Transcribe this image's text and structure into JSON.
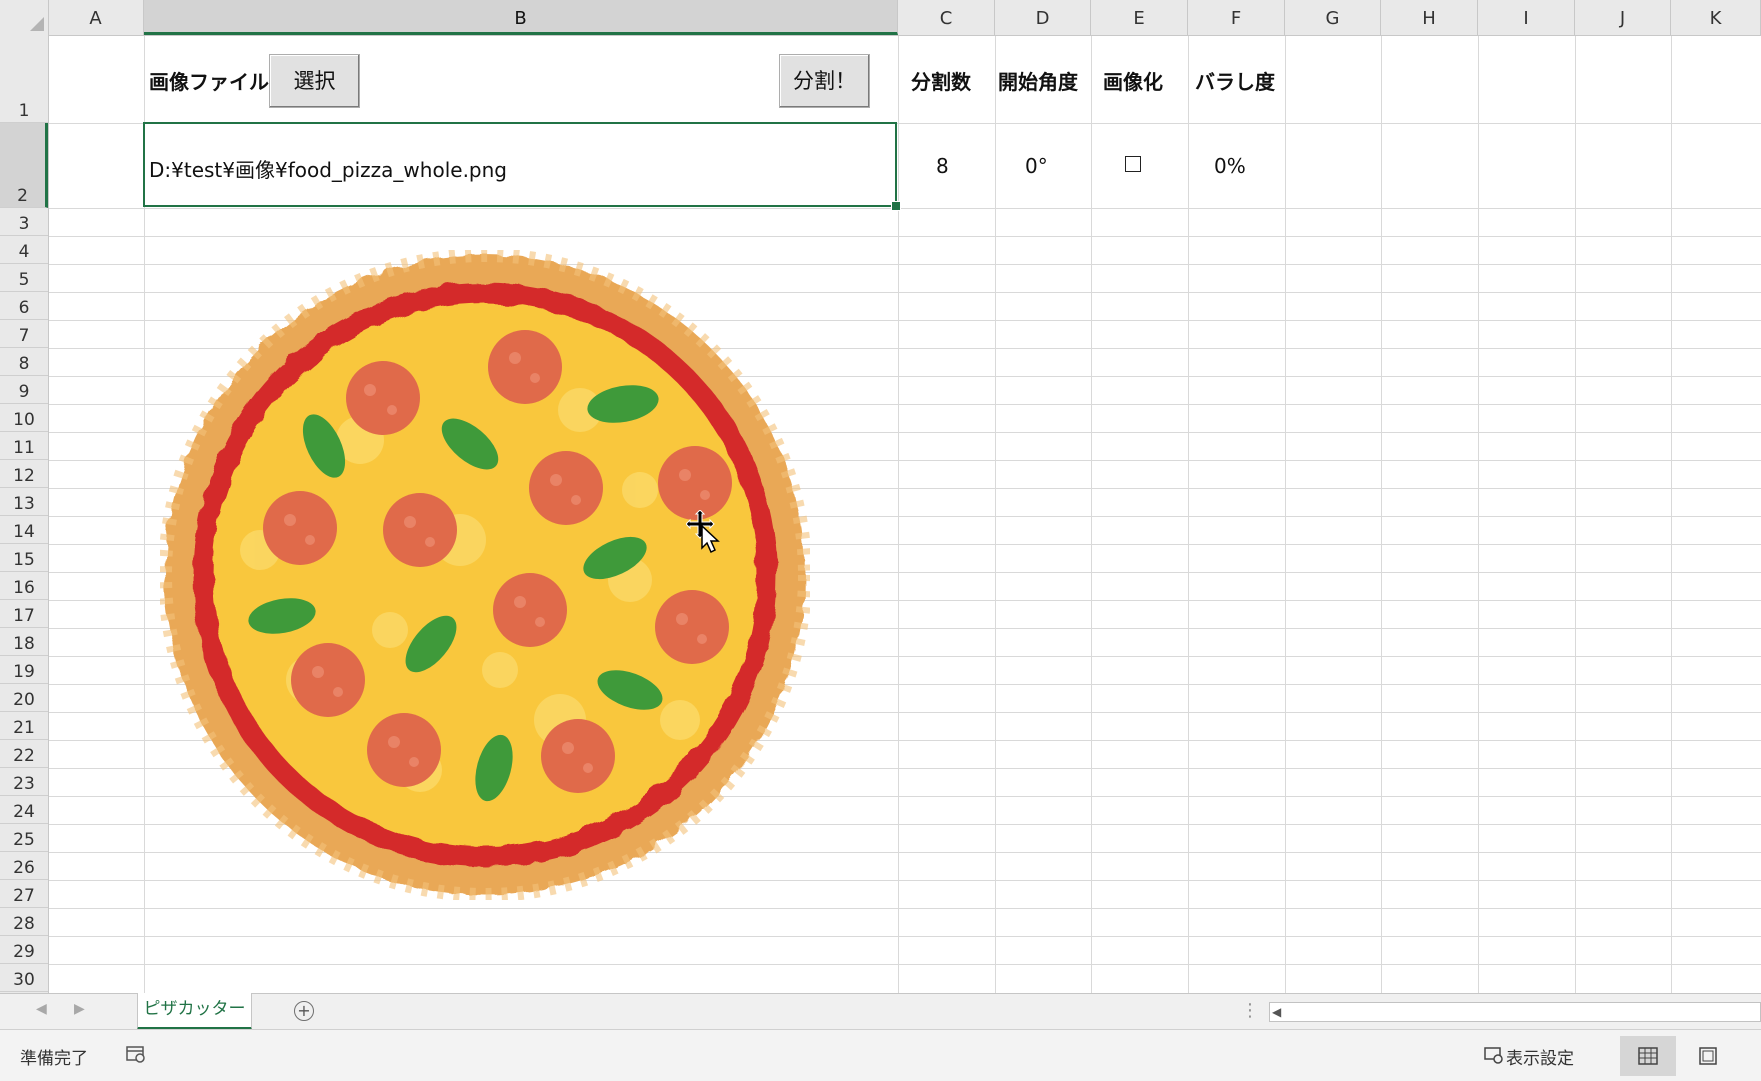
{
  "columns": [
    "A",
    "B",
    "C",
    "D",
    "E",
    "F",
    "G",
    "H",
    "I",
    "J",
    "K"
  ],
  "selected_column": "B",
  "rows": [
    "1",
    "2",
    "3",
    "4",
    "5",
    "6",
    "7",
    "8",
    "9",
    "10",
    "11",
    "12",
    "13",
    "14",
    "15",
    "16",
    "17",
    "18",
    "19",
    "20",
    "21",
    "22",
    "23",
    "24",
    "25",
    "26",
    "27",
    "28",
    "29",
    "30"
  ],
  "selected_row": "2",
  "row1": {
    "image_file_label": "画像ファイル",
    "select_button": "選択",
    "split_button": "分割！",
    "c_header": "分割数",
    "d_header": "開始角度",
    "e_header": "画像化",
    "f_header": "バラし度"
  },
  "row2": {
    "file_path": "D:¥test¥画像¥food_pizza_whole.png",
    "split_count": "8",
    "start_angle": "0°",
    "to_image_checked": false,
    "scatter": "0%"
  },
  "sheet_tab": "ピザカッター",
  "status": {
    "ready": "準備完了",
    "display_settings": "表示設定"
  },
  "colors": {
    "accent": "#217346",
    "pizza_crust": "#E9A857",
    "pizza_sauce": "#D42A2A",
    "pizza_cheese": "#F9C73C",
    "pepperoni": "#E06A4A",
    "basil": "#3F9A3A"
  },
  "icons": [
    "cursor-move-icon",
    "add-sheet-icon",
    "sheet-nav-left-icon",
    "sheet-nav-right-icon",
    "macro-status-icon",
    "display-settings-icon",
    "normal-view-icon",
    "page-layout-view-icon"
  ]
}
